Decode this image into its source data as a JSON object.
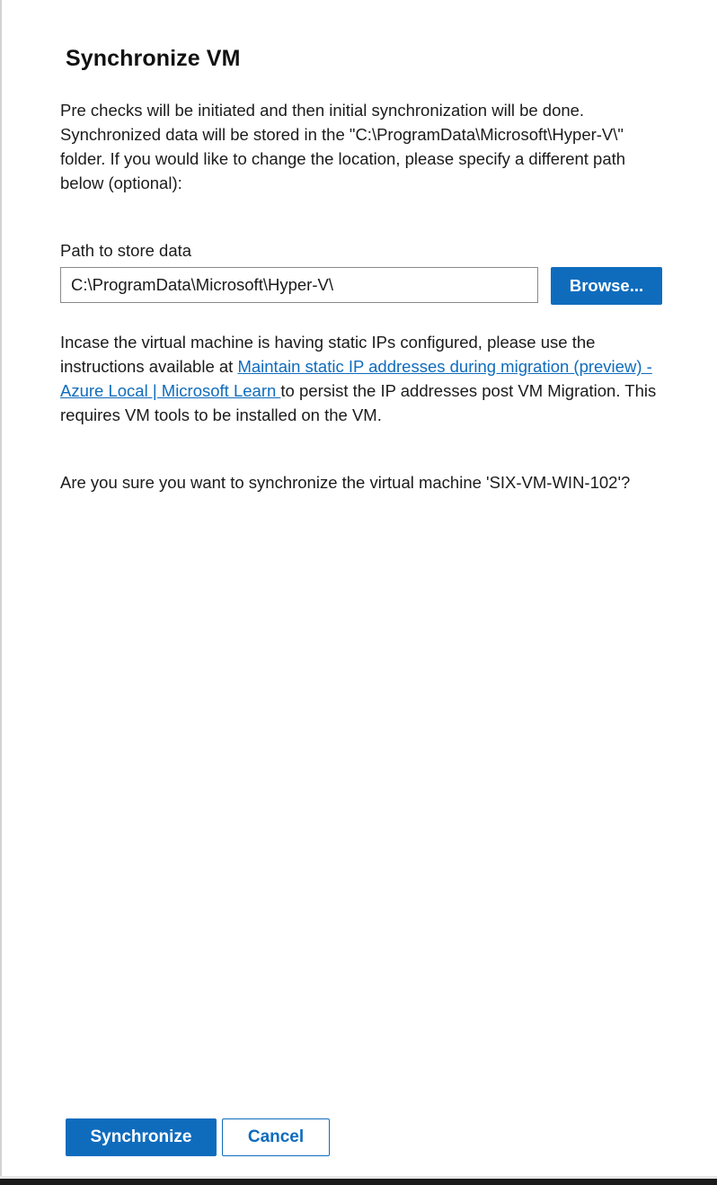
{
  "dialog": {
    "title": "Synchronize VM",
    "intro": "Pre checks will be initiated and then initial synchronization will be done. Synchronized data will be stored in the \"C:\\ProgramData\\Microsoft\\Hyper-V\\\" folder. If you would like to change the location, please specify a different path below (optional):",
    "path_label": "Path to store data",
    "path_value": "C:\\ProgramData\\Microsoft\\Hyper-V\\",
    "browse_label": "Browse...",
    "info_before": "Incase the virtual machine is having static IPs configured, please use the instructions available at ",
    "info_link": "Maintain static IP addresses during migration (preview) - Azure Local | Microsoft Learn ",
    "info_after": "to persist the IP addresses post VM Migration. This requires VM tools to be installed on the VM.",
    "confirm": "Are you sure you want to synchronize the virtual machine 'SIX-VM-WIN-102'?"
  },
  "footer": {
    "synchronize_label": "Synchronize",
    "cancel_label": "Cancel"
  },
  "colors": {
    "accent": "#0f6cbd",
    "text": "#1b1b1b",
    "background": "#ffffff"
  }
}
